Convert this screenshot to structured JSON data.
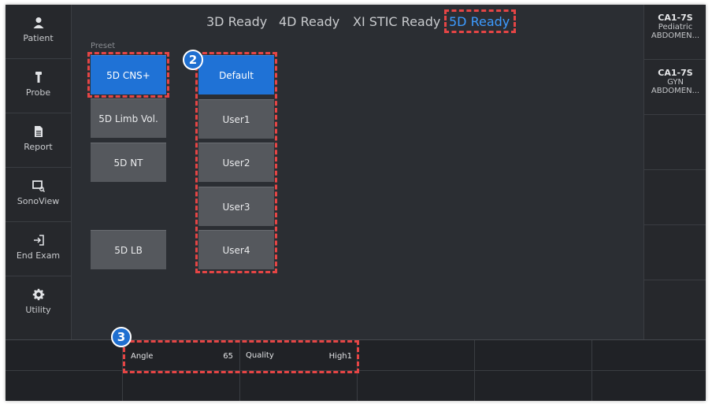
{
  "sidebar": {
    "items": [
      {
        "label": "Patient",
        "icon": "person-icon"
      },
      {
        "label": "Probe",
        "icon": "probe-icon"
      },
      {
        "label": "Report",
        "icon": "document-icon"
      },
      {
        "label": "SonoView",
        "icon": "image-search-icon"
      },
      {
        "label": "End Exam",
        "icon": "exit-icon"
      },
      {
        "label": "Utility",
        "icon": "gear-icon"
      }
    ]
  },
  "tabs": [
    "3D Ready",
    "4D Ready",
    "XI STIC Ready",
    "5D Ready"
  ],
  "active_tab": "5D Ready",
  "preset": {
    "label": "Preset",
    "buttons": [
      "5D CNS+",
      "5D Limb Vol.",
      "5D NT",
      "5D LB"
    ],
    "selected": "5D CNS+"
  },
  "user_presets": {
    "buttons": [
      "Default",
      "User1",
      "User2",
      "User3",
      "User4"
    ],
    "selected": "Default"
  },
  "probes": [
    {
      "name": "CA1-7S",
      "line1": "Pediatric",
      "line2": "ABDOMEN..."
    },
    {
      "name": "CA1-7S",
      "line1": "GYN",
      "line2": "ABDOMEN..."
    }
  ],
  "params": {
    "angle_label": "Angle",
    "angle_value": "65",
    "quality_label": "Quality",
    "quality_value": "High1"
  },
  "callouts": {
    "badge2": "2",
    "badge3": "3"
  },
  "colors": {
    "accent": "#1f72d6",
    "highlight": "#e54545",
    "tab_active": "#3d9bff"
  }
}
